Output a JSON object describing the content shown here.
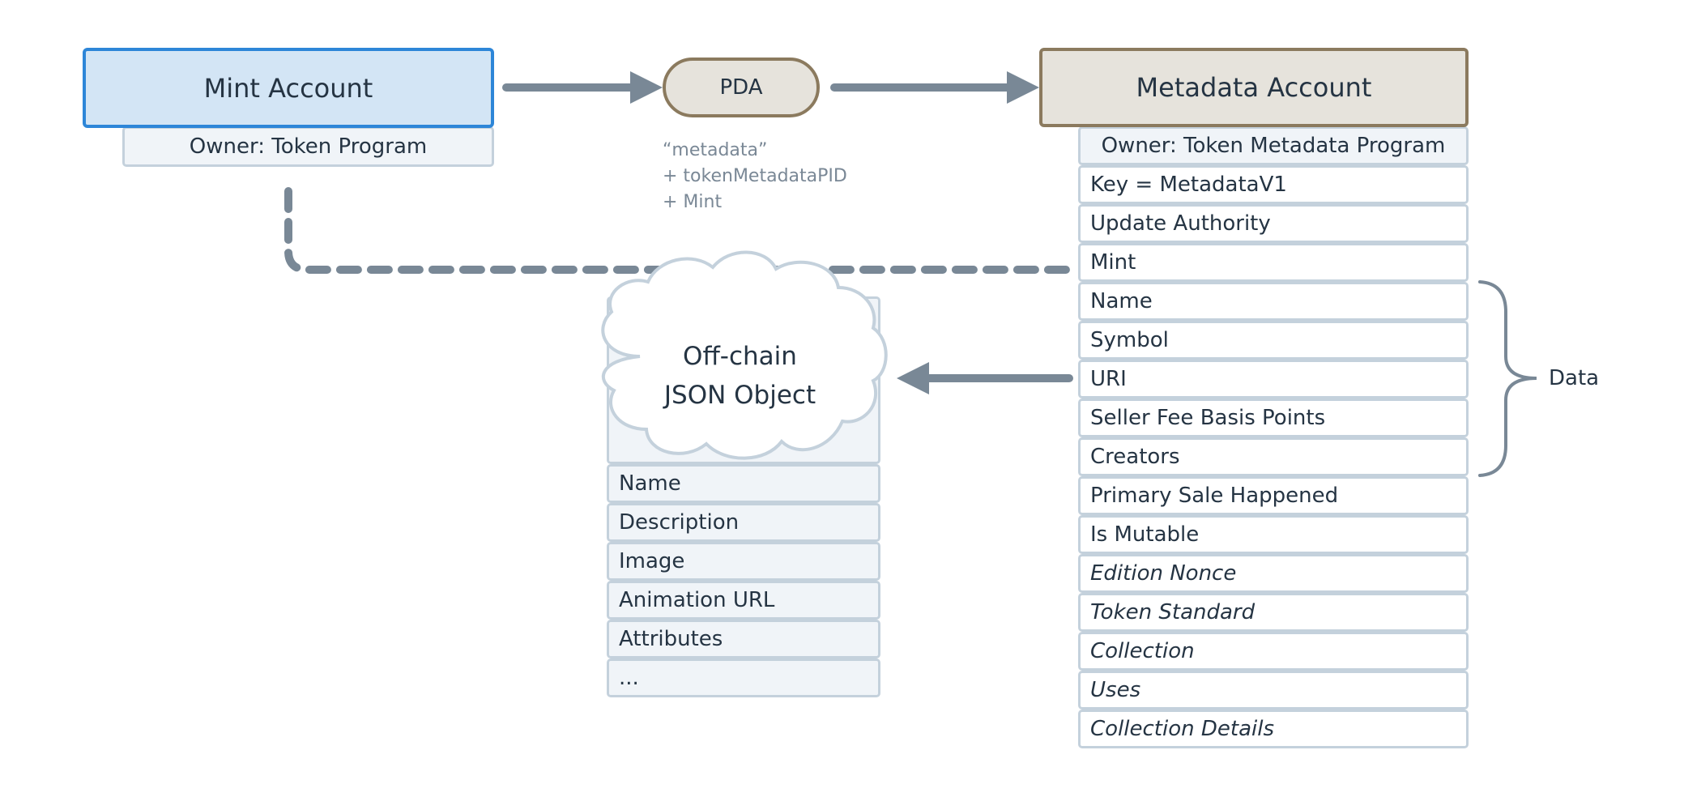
{
  "diagram": {
    "mint_account": {
      "title": "Mint Account",
      "owner": "Owner: Token Program"
    },
    "pda": {
      "label": "PDA",
      "seeds": [
        "“metadata”",
        "+ tokenMetadataPID",
        "+ Mint"
      ]
    },
    "metadata_account": {
      "title": "Metadata Account",
      "owner": "Owner: Token Metadata Program",
      "fields": [
        {
          "label": "Key = MetadataV1",
          "italic": false
        },
        {
          "label": "Update Authority",
          "italic": false
        },
        {
          "label": "Mint",
          "italic": false
        },
        {
          "label": "Name",
          "italic": false
        },
        {
          "label": "Symbol",
          "italic": false
        },
        {
          "label": "URI",
          "italic": false
        },
        {
          "label": "Seller Fee Basis Points",
          "italic": false
        },
        {
          "label": "Creators",
          "italic": false
        },
        {
          "label": "Primary Sale Happened",
          "italic": false
        },
        {
          "label": "Is Mutable",
          "italic": false
        },
        {
          "label": "Edition Nonce",
          "italic": true
        },
        {
          "label": "Token Standard",
          "italic": true
        },
        {
          "label": "Collection",
          "italic": true
        },
        {
          "label": "Uses",
          "italic": true
        },
        {
          "label": "Collection Details",
          "italic": true
        }
      ],
      "data_group_label": "Data",
      "data_group_fields": [
        "Name",
        "Symbol",
        "URI",
        "Seller Fee Basis Points",
        "Creators"
      ]
    },
    "offchain_json": {
      "title_line1": "Off-chain",
      "title_line2": "JSON Object",
      "fields": [
        "Name",
        "Description",
        "Image",
        "Animation URL",
        "Attributes",
        "..."
      ]
    },
    "connections": [
      {
        "from": "Mint Account",
        "to": "PDA",
        "style": "solid-arrow"
      },
      {
        "from": "PDA",
        "to": "Metadata Account",
        "style": "solid-arrow"
      },
      {
        "from": "Metadata Account.Mint",
        "to": "Mint Account",
        "style": "dashed"
      },
      {
        "from": "Metadata Account.URI",
        "to": "Off-chain JSON Object",
        "style": "solid-arrow"
      }
    ],
    "colors": {
      "mint_fill": "#d3e5f5",
      "mint_border": "#2d86d8",
      "metadata_fill": "#e6e3dc",
      "metadata_border": "#8b7a5e",
      "row_border": "#c4d1dc",
      "row_fill_alt": "#f0f4f8",
      "connector": "#798896",
      "text": "#253443",
      "muted_text": "#7a8896"
    }
  }
}
